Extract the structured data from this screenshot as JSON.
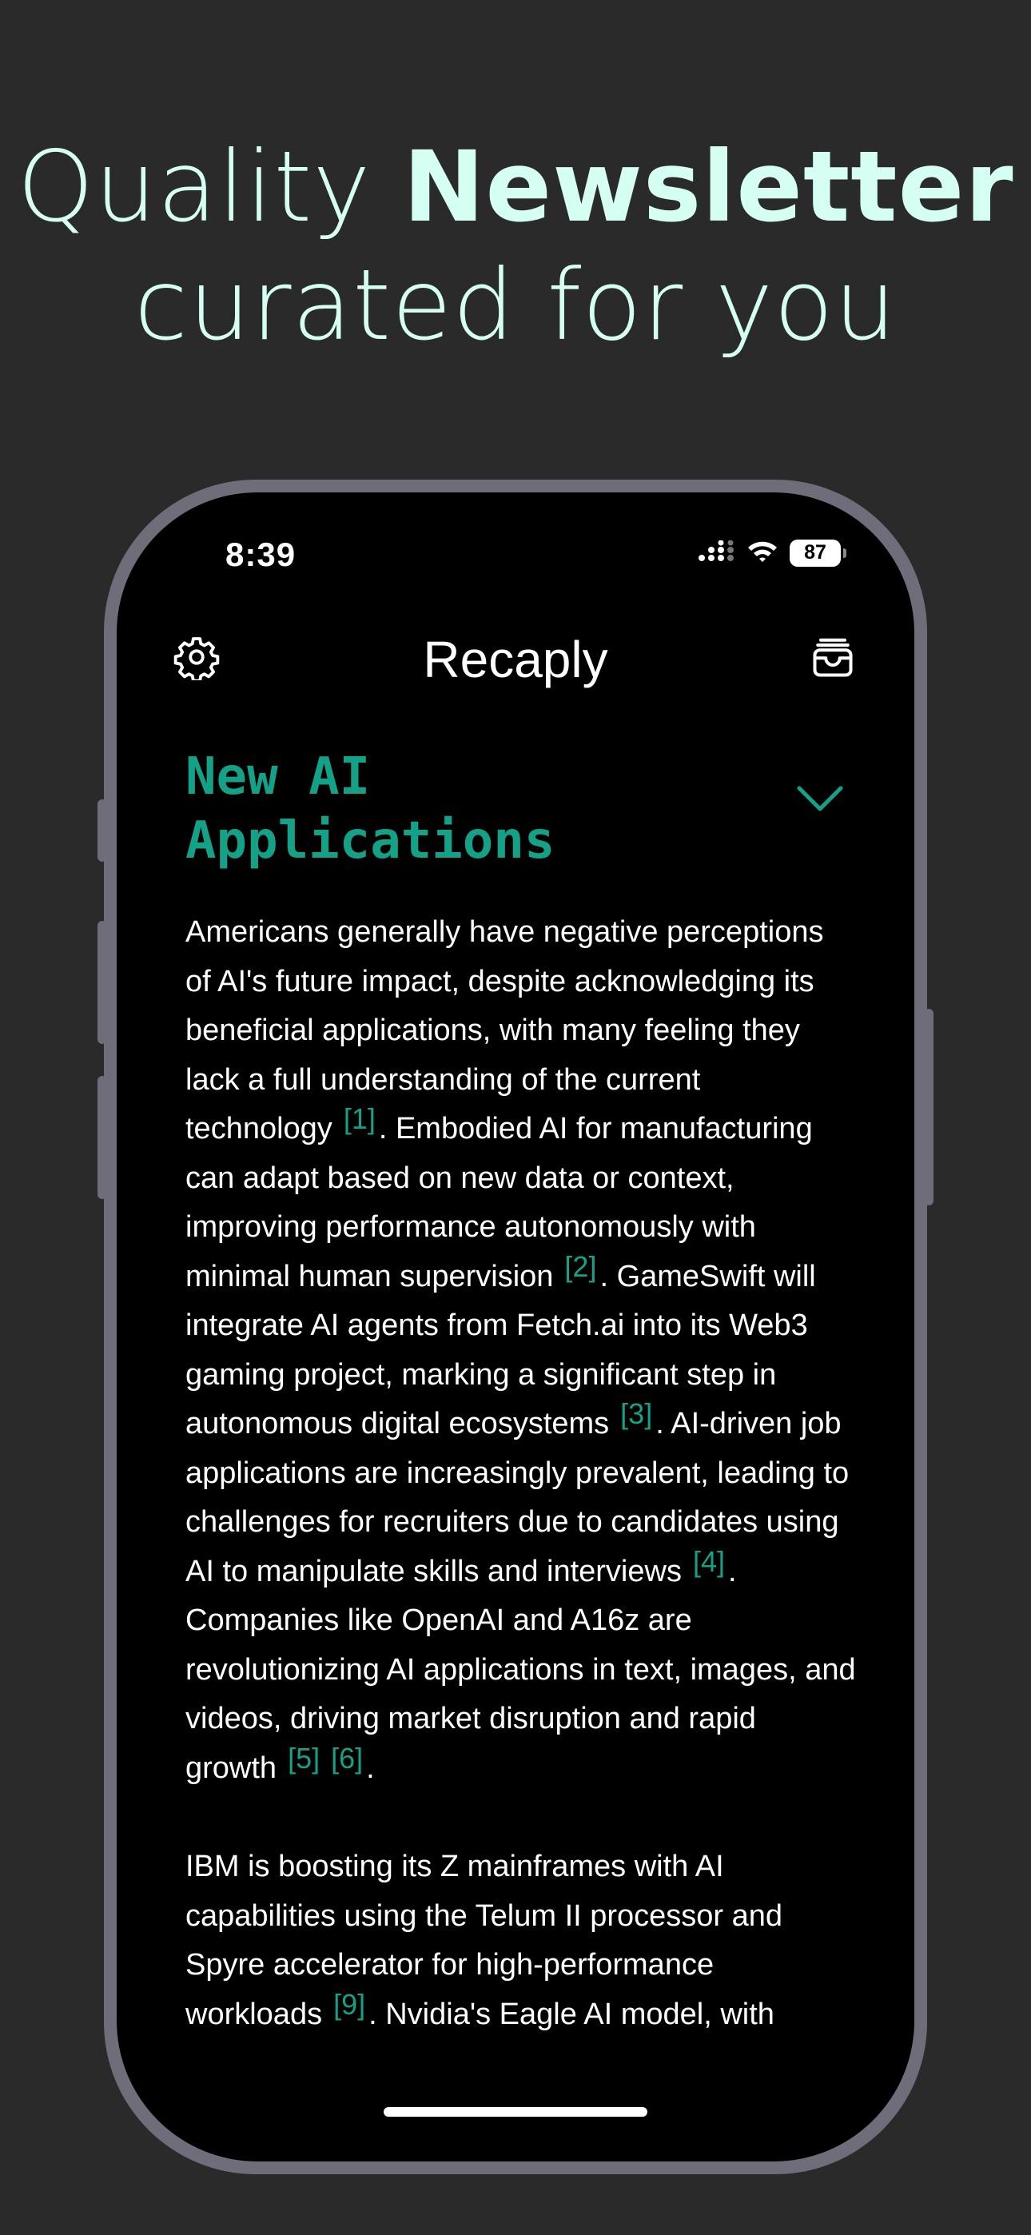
{
  "headline": {
    "line1_light": "Quality ",
    "line1_bold": "Newsletter",
    "line2": "curated for you"
  },
  "status_bar": {
    "time": "8:39",
    "battery": "87",
    "icons": [
      "cellular-signal-icon",
      "wifi-icon",
      "battery-icon"
    ]
  },
  "nav": {
    "title": "Recaply",
    "left_icon": "gear-icon",
    "right_icon": "wallet-icon"
  },
  "section": {
    "title": "New AI Applications",
    "toggle_icon": "chevron-down-icon"
  },
  "paragraphs": [
    {
      "segments": [
        {
          "text": "Americans generally have negative perceptions of AI's future impact, despite acknowledging its beneficial applications, with many feeling they lack a full understanding of the current technology",
          "cites": [
            "[1]"
          ],
          "after": "."
        },
        {
          "text": " Embodied AI for manufacturing can adapt based on new data or context, improving performance autonomously with minimal human supervision",
          "cites": [
            "[2]"
          ],
          "after": "."
        },
        {
          "text": " GameSwift will integrate AI agents from Fetch.ai into its Web3 gaming project, marking a significant step in autonomous digital ecosystems",
          "cites": [
            "[3]"
          ],
          "after": "."
        },
        {
          "text": " AI-driven job applications are increasingly prevalent, leading to challenges for recruiters due to candidates using AI to manipulate skills and interviews",
          "cites": [
            "[4]"
          ],
          "after": "."
        },
        {
          "text": " Companies like OpenAI and A16z are revolutionizing AI applications in text, images, and videos, driving market disruption and rapid growth",
          "cites": [
            "[5]",
            "[6]"
          ],
          "after": "."
        }
      ]
    },
    {
      "segments": [
        {
          "text": "IBM is boosting its Z mainframes with AI capabilities using the Telum II processor and Spyre accelerator for high-performance workloads",
          "cites": [
            "[9]"
          ],
          "after": "."
        },
        {
          "text": " Nvidia's Eagle AI model, with",
          "cites": [],
          "after": ""
        }
      ]
    }
  ],
  "colors": {
    "background": "#2a2a2a",
    "headline": "#d6fff4",
    "accent": "#13a187",
    "phone_frame": "#6f6d7a",
    "screen": "#000000"
  }
}
